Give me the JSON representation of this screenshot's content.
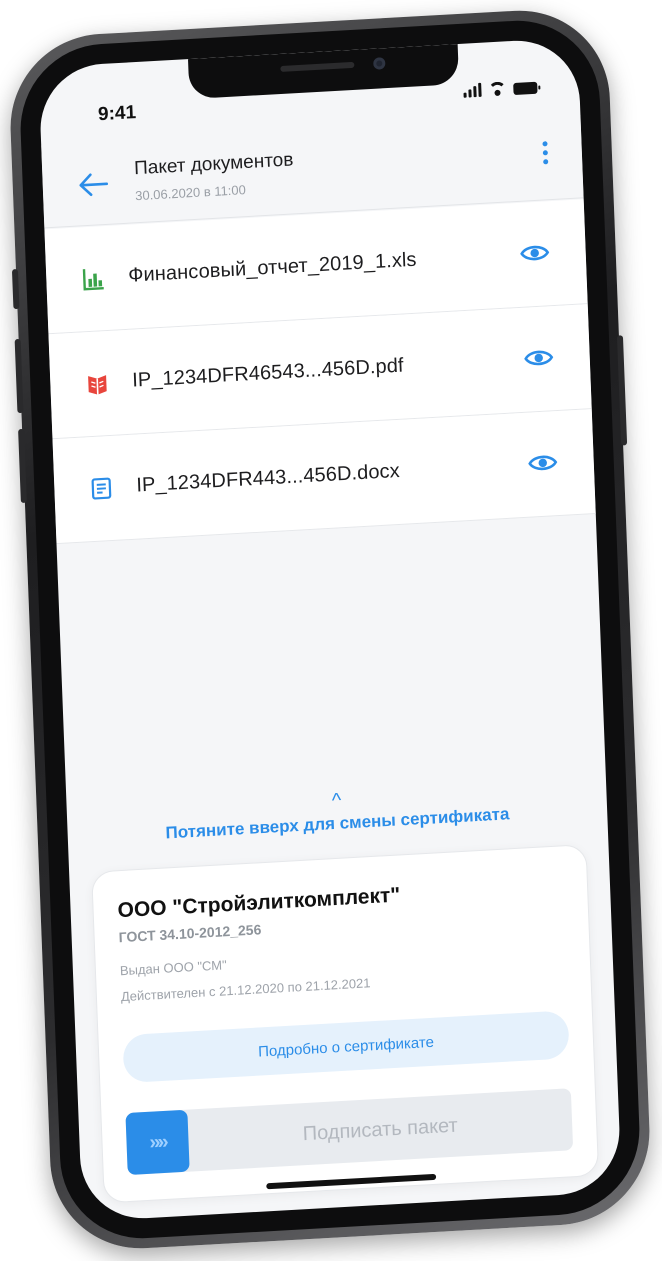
{
  "status_bar": {
    "time": "9:41"
  },
  "header": {
    "title": "Пакет документов",
    "subtitle": "30.06.2020 в 11:00",
    "back_icon": "arrow-left-icon",
    "menu_icon": "more-vertical-icon"
  },
  "documents": [
    {
      "name": "Финансовый_отчет_2019_1.xls",
      "icon": "spreadsheet-icon",
      "icon_color": "#3aa34a"
    },
    {
      "name": "IP_1234DFR46543...456D.pdf",
      "icon": "pdf-book-icon",
      "icon_color": "#e8453c"
    },
    {
      "name": "IP_1234DFR443...456D.docx",
      "icon": "text-document-icon",
      "icon_color": "#2b8de8"
    }
  ],
  "pull_hint": {
    "chevron": "^",
    "text": "Потяните вверх для смены сертификата"
  },
  "certificate": {
    "organization": "ООО \"Стройэлиткомплект\"",
    "algorithm": "ГОСТ 34.10-2012_256",
    "issuer": "Выдан ООО \"СМ\"",
    "validity": "Действителен с 21.12.2020 по 21.12.2021",
    "details_button": "Подробно о сертификате"
  },
  "sign_slider": {
    "handle_glyph": "»»",
    "label": "Подписать пакет"
  },
  "colors": {
    "accent": "#2b8de8",
    "accent_light": "#e5f1fc",
    "background": "#f5f6f8"
  }
}
